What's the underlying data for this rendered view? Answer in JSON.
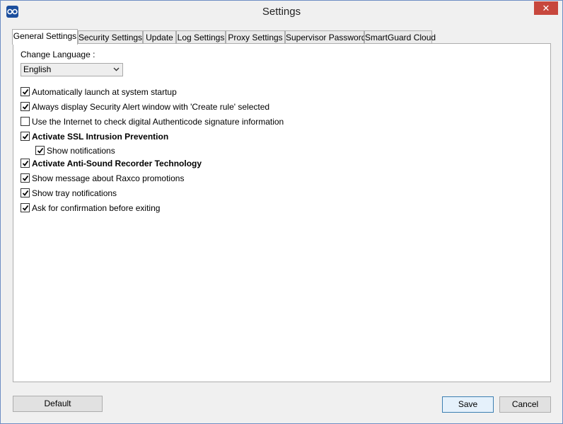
{
  "window": {
    "title": "Settings",
    "close_glyph": "✕"
  },
  "tabs": [
    {
      "label": "General Settings",
      "active": true
    },
    {
      "label": "Security Settings",
      "active": false
    },
    {
      "label": "Update",
      "active": false
    },
    {
      "label": "Log Settings",
      "active": false
    },
    {
      "label": "Proxy Settings",
      "active": false
    },
    {
      "label": "Supervisor Password",
      "active": false
    },
    {
      "label": "SmartGuard Cloud",
      "active": false
    }
  ],
  "general": {
    "language_label": "Change Language :",
    "language_value": "English",
    "options": [
      {
        "label": "Automatically launch at system startup",
        "checked": true
      },
      {
        "label": "Always display Security Alert window with  'Create rule' selected",
        "checked": true
      },
      {
        "label": "Use the Internet to check digital Authenticode signature information",
        "checked": false
      },
      {
        "label": "Activate SSL Intrusion Prevention",
        "checked": true
      },
      {
        "label": "Show notifications",
        "checked": true
      },
      {
        "label": "Activate Anti-Sound Recorder Technology",
        "checked": true
      },
      {
        "label": "Show message about Raxco promotions",
        "checked": true
      },
      {
        "label": "Show tray notifications",
        "checked": true
      },
      {
        "label": "Ask for confirmation before exiting",
        "checked": true
      }
    ]
  },
  "buttons": {
    "default_label": "Default",
    "save_label": "Save",
    "cancel_label": "Cancel"
  },
  "colors": {
    "accent": "#3c7fb1",
    "close": "#c7473d",
    "app_icon": "#1c4f9e"
  }
}
